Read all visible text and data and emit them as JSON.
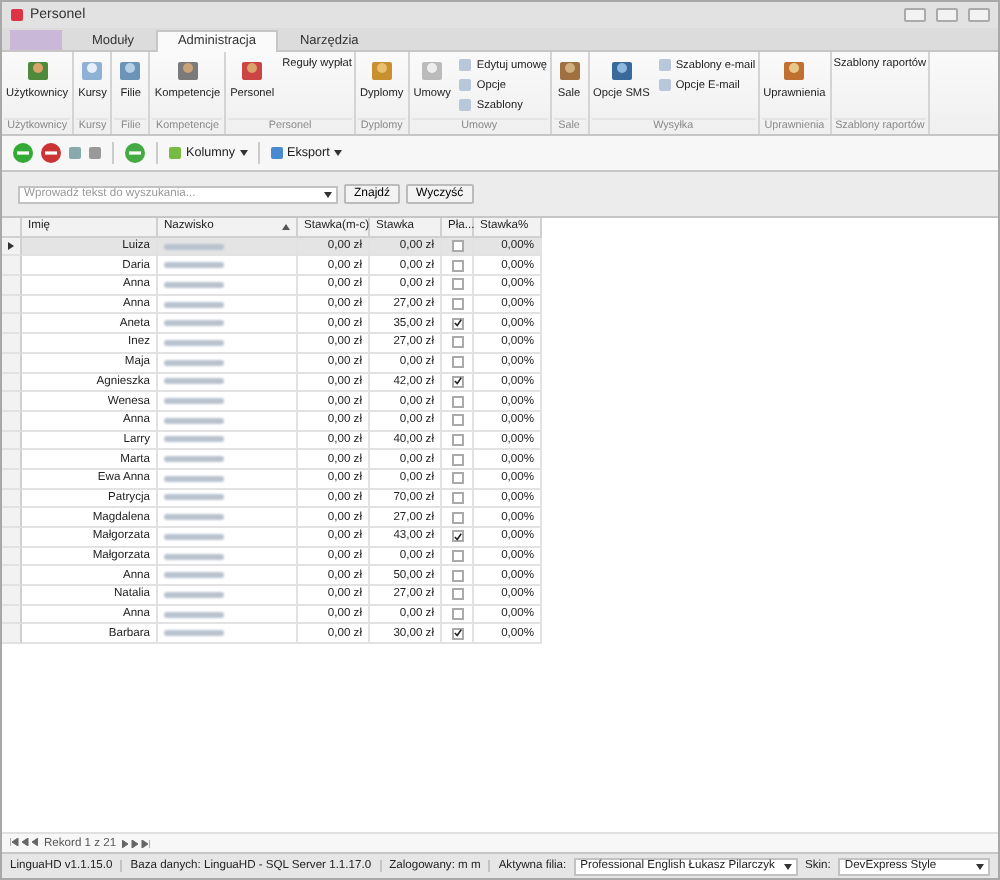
{
  "window": {
    "title": "Personel"
  },
  "tabs": [
    {
      "label": "Moduły",
      "selected": false
    },
    {
      "label": "Administracja",
      "selected": true
    },
    {
      "label": "Narzędzia",
      "selected": false
    }
  ],
  "ribbon": [
    {
      "label": "Użytkownicy",
      "items": [
        {
          "label": "Użytkownicy",
          "kind": "large"
        }
      ]
    },
    {
      "label": "Kursy",
      "items": [
        {
          "label": "Kursy",
          "kind": "large"
        }
      ]
    },
    {
      "label": "Filie",
      "items": [
        {
          "label": "Filie",
          "kind": "large"
        }
      ]
    },
    {
      "label": "Kompetencje",
      "items": [
        {
          "label": "Kompetencje",
          "kind": "large"
        }
      ]
    },
    {
      "label": "Personel",
      "items": [
        {
          "label": "Personel",
          "kind": "large"
        },
        {
          "label": "Reguły wypłat",
          "kind": "small"
        }
      ]
    },
    {
      "label": "Dyplomy",
      "items": [
        {
          "label": "Dyplomy",
          "kind": "large"
        }
      ]
    },
    {
      "label": "Umowy",
      "items": [
        {
          "label": "Umowy",
          "kind": "large"
        },
        {
          "label": "Edytuj umowę",
          "kind": "small"
        },
        {
          "label": "Opcje",
          "kind": "small"
        },
        {
          "label": "Szablony",
          "kind": "small"
        }
      ]
    },
    {
      "label": "Sale",
      "items": [
        {
          "label": "Sale",
          "kind": "large"
        }
      ]
    },
    {
      "label": "Wysyłka",
      "items": [
        {
          "label": "Opcje SMS",
          "kind": "large"
        },
        {
          "label": "Szablony e-mail",
          "kind": "small"
        },
        {
          "label": "Opcje E-mail",
          "kind": "small"
        }
      ]
    },
    {
      "label": "Uprawnienia",
      "items": [
        {
          "label": "Uprawnienia",
          "kind": "large"
        }
      ]
    },
    {
      "label": "Szablony raportów",
      "items": [
        {
          "label": "Szablony raportów",
          "kind": "small"
        }
      ]
    }
  ],
  "toolbar": {
    "columns": "Kolumny",
    "export": "Eksport"
  },
  "search": {
    "placeholder": "Wprowadź tekst do wyszukania...",
    "find": "Znajdź",
    "clear": "Wyczyść"
  },
  "columns": [
    "Imię",
    "Nazwisko",
    "Stawka(m-c)",
    "Stawka",
    "Pła...",
    "Stawka%"
  ],
  "rows": [
    {
      "first": "Luiza",
      "monthly": "0,00 zł",
      "rate": "0,00 zł",
      "paid": false,
      "percent": "0,00%",
      "selected": true
    },
    {
      "first": "Daria",
      "monthly": "0,00 zł",
      "rate": "0,00 zł",
      "paid": false,
      "percent": "0,00%",
      "selected": false
    },
    {
      "first": "Anna",
      "monthly": "0,00 zł",
      "rate": "0,00 zł",
      "paid": false,
      "percent": "0,00%",
      "selected": false
    },
    {
      "first": "Anna",
      "monthly": "0,00 zł",
      "rate": "27,00 zł",
      "paid": false,
      "percent": "0,00%",
      "selected": false
    },
    {
      "first": "Aneta",
      "monthly": "0,00 zł",
      "rate": "35,00 zł",
      "paid": true,
      "percent": "0,00%",
      "selected": false
    },
    {
      "first": "Inez",
      "monthly": "0,00 zł",
      "rate": "27,00 zł",
      "paid": false,
      "percent": "0,00%",
      "selected": false
    },
    {
      "first": "Maja",
      "monthly": "0,00 zł",
      "rate": "0,00 zł",
      "paid": false,
      "percent": "0,00%",
      "selected": false
    },
    {
      "first": "Agnieszka",
      "monthly": "0,00 zł",
      "rate": "42,00 zł",
      "paid": true,
      "percent": "0,00%",
      "selected": false
    },
    {
      "first": "Wenesa",
      "monthly": "0,00 zł",
      "rate": "0,00 zł",
      "paid": false,
      "percent": "0,00%",
      "selected": false
    },
    {
      "first": "Anna",
      "monthly": "0,00 zł",
      "rate": "0,00 zł",
      "paid": false,
      "percent": "0,00%",
      "selected": false
    },
    {
      "first": "Larry",
      "monthly": "0,00 zł",
      "rate": "40,00 zł",
      "paid": false,
      "percent": "0,00%",
      "selected": false
    },
    {
      "first": "Marta",
      "monthly": "0,00 zł",
      "rate": "0,00 zł",
      "paid": false,
      "percent": "0,00%",
      "selected": false
    },
    {
      "first": "Ewa Anna",
      "monthly": "0,00 zł",
      "rate": "0,00 zł",
      "paid": false,
      "percent": "0,00%",
      "selected": false
    },
    {
      "first": "Patrycja",
      "monthly": "0,00 zł",
      "rate": "70,00 zł",
      "paid": false,
      "percent": "0,00%",
      "selected": false
    },
    {
      "first": "Magdalena",
      "monthly": "0,00 zł",
      "rate": "27,00 zł",
      "paid": false,
      "percent": "0,00%",
      "selected": false
    },
    {
      "first": "Małgorzata",
      "monthly": "0,00 zł",
      "rate": "43,00 zł",
      "paid": true,
      "percent": "0,00%",
      "selected": false
    },
    {
      "first": "Małgorzata",
      "monthly": "0,00 zł",
      "rate": "0,00 zł",
      "paid": false,
      "percent": "0,00%",
      "selected": false
    },
    {
      "first": "Anna",
      "monthly": "0,00 zł",
      "rate": "50,00 zł",
      "paid": false,
      "percent": "0,00%",
      "selected": false
    },
    {
      "first": "Natalia",
      "monthly": "0,00 zł",
      "rate": "27,00 zł",
      "paid": false,
      "percent": "0,00%",
      "selected": false
    },
    {
      "first": "Anna",
      "monthly": "0,00 zł",
      "rate": "0,00 zł",
      "paid": false,
      "percent": "0,00%",
      "selected": false
    },
    {
      "first": "Barbara",
      "monthly": "0,00 zł",
      "rate": "30,00 zł",
      "paid": true,
      "percent": "0,00%",
      "selected": false
    }
  ],
  "navigator": {
    "record": "Rekord 1 z 21"
  },
  "status_bar": {
    "version": "LinguaHD v1.1.15.0",
    "database": "Baza danych: LinguaHD - SQL Server 1.1.17.0",
    "user": "Zalogowany: m m",
    "branch_label": "Aktywna filia:",
    "branch": "Professional English Łukasz Pilarczyk",
    "skin_label": "Skin:",
    "skin": "DevExpress Style"
  }
}
